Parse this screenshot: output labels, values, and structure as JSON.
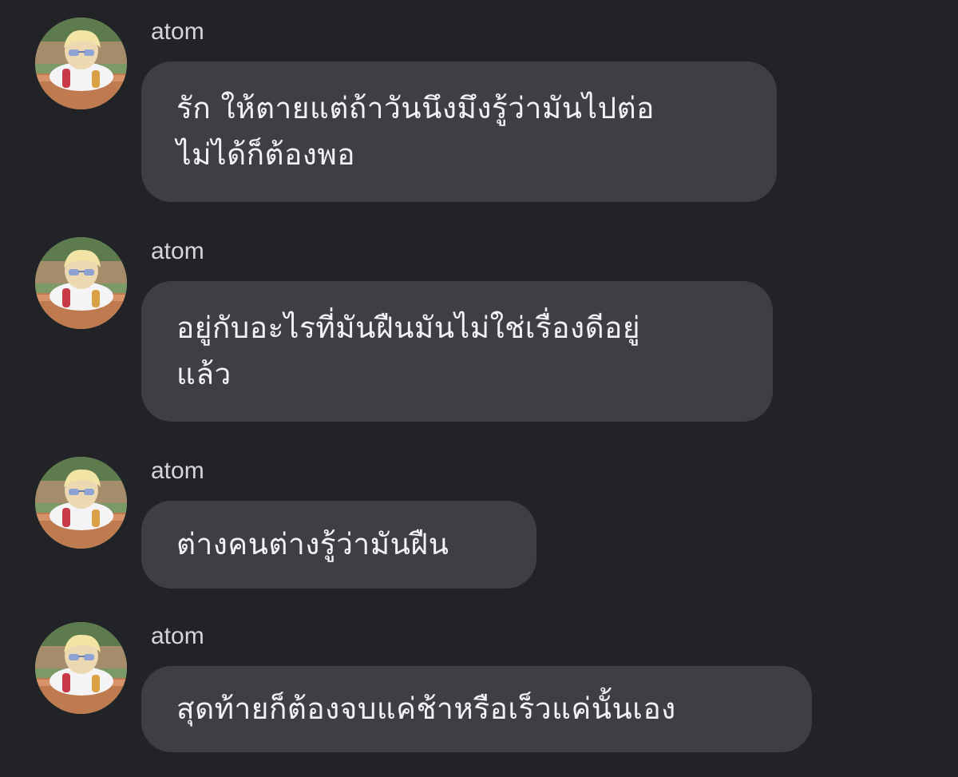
{
  "colors": {
    "background": "#222327",
    "bubble": "#3e3f44",
    "message_text": "#f2f2f4",
    "sender_text": "#d6d6da"
  },
  "avatar_icon": "profile-photo-avatar",
  "messages": [
    {
      "sender": "atom",
      "text": "รัก ให้ตายแต่ถ้าวันนึงมึงรู้ว่ามันไปต่อ\nไม่ได้ก็ต้องพอ"
    },
    {
      "sender": "atom",
      "text": "อยู่กับอะไรที่มันฝืนมันไม่ใช่เรื่องดีอยู่\nแล้ว"
    },
    {
      "sender": "atom",
      "text": "ต่างคนต่างรู้ว่ามันฝืน"
    },
    {
      "sender": "atom",
      "text": "สุดท้ายก็ต้องจบแค่ช้าหรือเร็วแค่นั้นเอง"
    }
  ]
}
